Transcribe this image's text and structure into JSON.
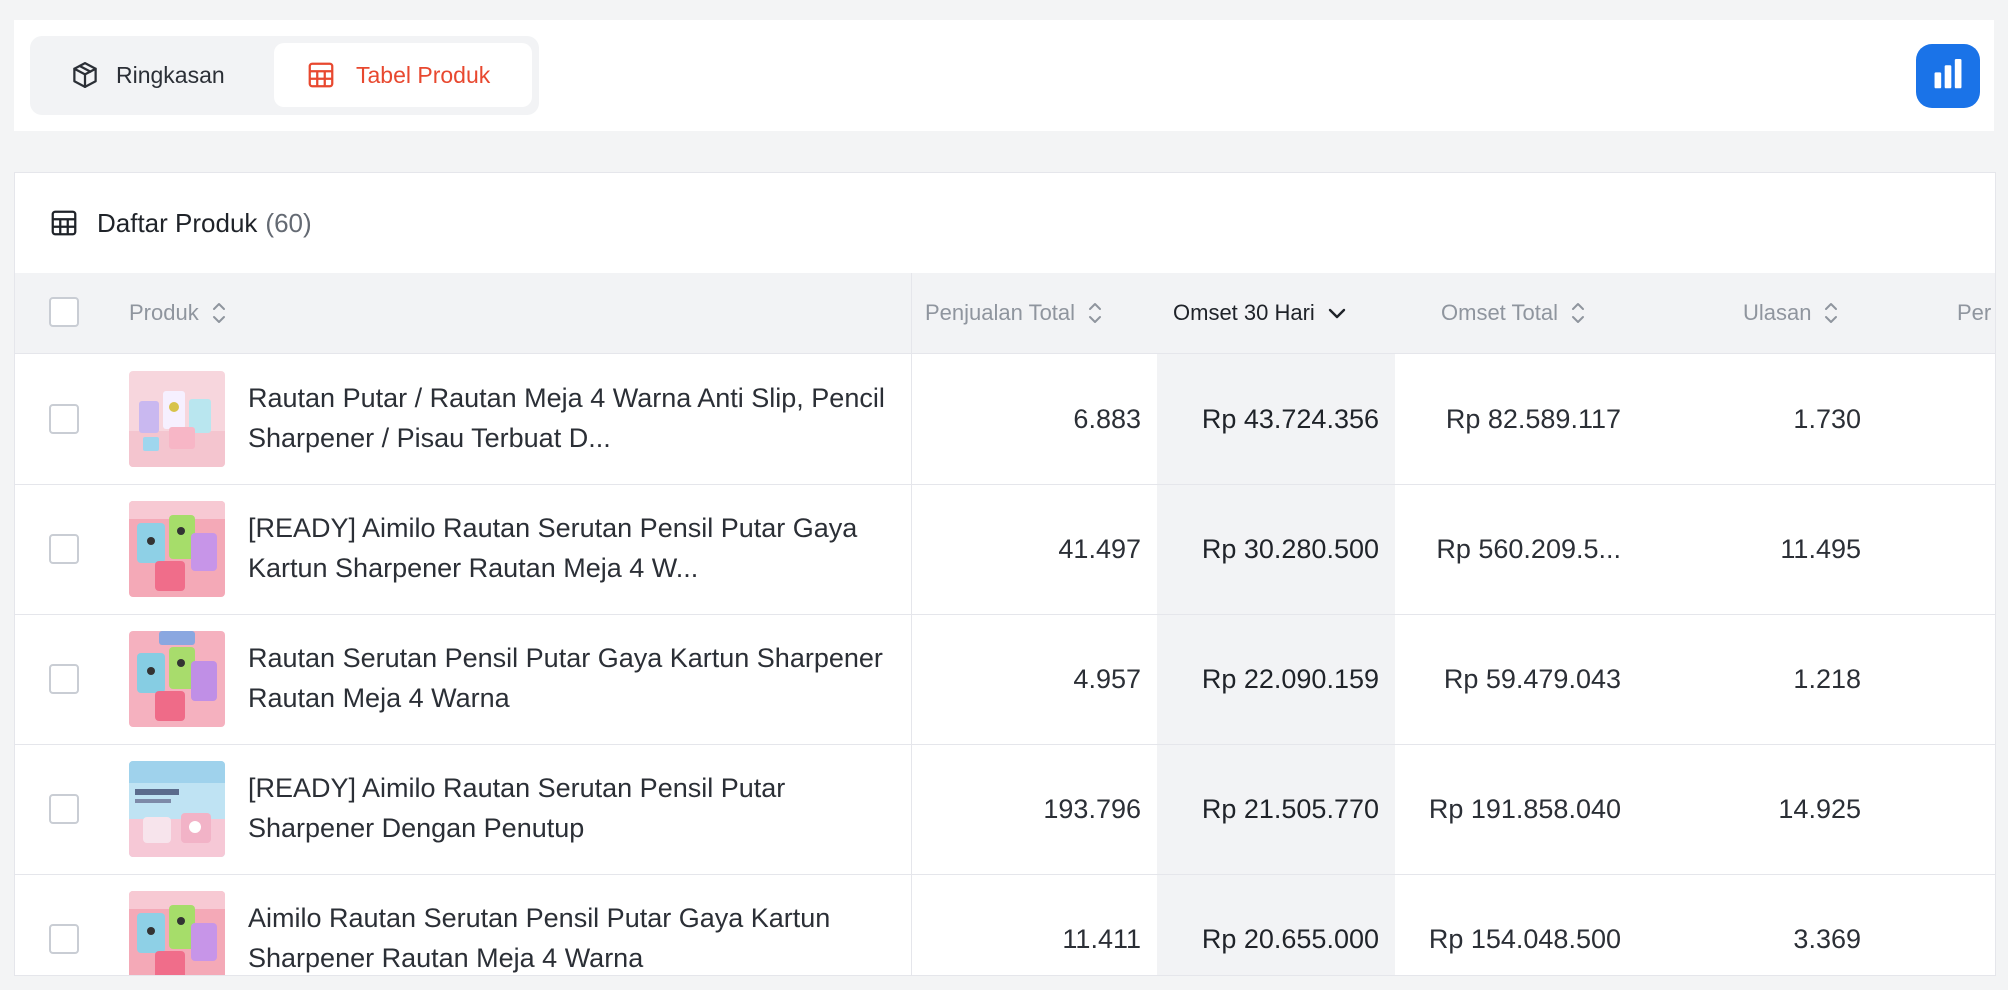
{
  "tabs": {
    "ringkasan_label": "Ringkasan",
    "tabel_label": "Tabel Produk",
    "active": "Tabel Produk"
  },
  "header": {
    "title": "Daftar Produk",
    "count": "(60)"
  },
  "columns": {
    "produk": "Produk",
    "penjualan_total": "Penjualan Total",
    "omset_30_hari": "Omset 30 Hari",
    "omset_total": "Omset Total",
    "ulasan": "Ulasan",
    "next_partial": "Per"
  },
  "rows": [
    {
      "name": "Rautan Putar / Rautan Meja 4 Warna Anti Slip, Pencil Sharpener / Pisau Terbuat D...",
      "penjualan_total": "6.883",
      "omset_30_hari": "Rp 43.724.356",
      "omset_total": "Rp 82.589.117",
      "ulasan": "1.730"
    },
    {
      "name": "[READY] Aimilo Rautan Serutan Pensil Putar Gaya Kartun Sharpener Rautan Meja 4 W...",
      "penjualan_total": "41.497",
      "omset_30_hari": "Rp 30.280.500",
      "omset_total": "Rp 560.209.5...",
      "ulasan": "11.495"
    },
    {
      "name": "Rautan Serutan Pensil Putar Gaya Kartun Sharpener Rautan Meja 4 Warna",
      "penjualan_total": "4.957",
      "omset_30_hari": "Rp 22.090.159",
      "omset_total": "Rp 59.479.043",
      "ulasan": "1.218"
    },
    {
      "name": "[READY] Aimilo Rautan Serutan Pensil Putar Sharpener Dengan Penutup",
      "penjualan_total": "193.796",
      "omset_30_hari": "Rp 21.505.770",
      "omset_total": "Rp 191.858.040",
      "ulasan": "14.925"
    },
    {
      "name": "Aimilo Rautan Serutan Pensil Putar Gaya Kartun Sharpener Rautan Meja 4 Warna",
      "penjualan_total": "11.411",
      "omset_30_hari": "Rp 20.655.000",
      "omset_total": "Rp 154.048.500",
      "ulasan": "3.369"
    }
  ],
  "colors": {
    "accent": "#e8482f",
    "chart_button": "#1a73e8",
    "header_bg": "#f2f3f5"
  },
  "icons": {
    "ringkasan": "box-icon",
    "tabel": "table-icon",
    "chart_button": "bar-chart-icon",
    "card_header": "table-icon"
  }
}
